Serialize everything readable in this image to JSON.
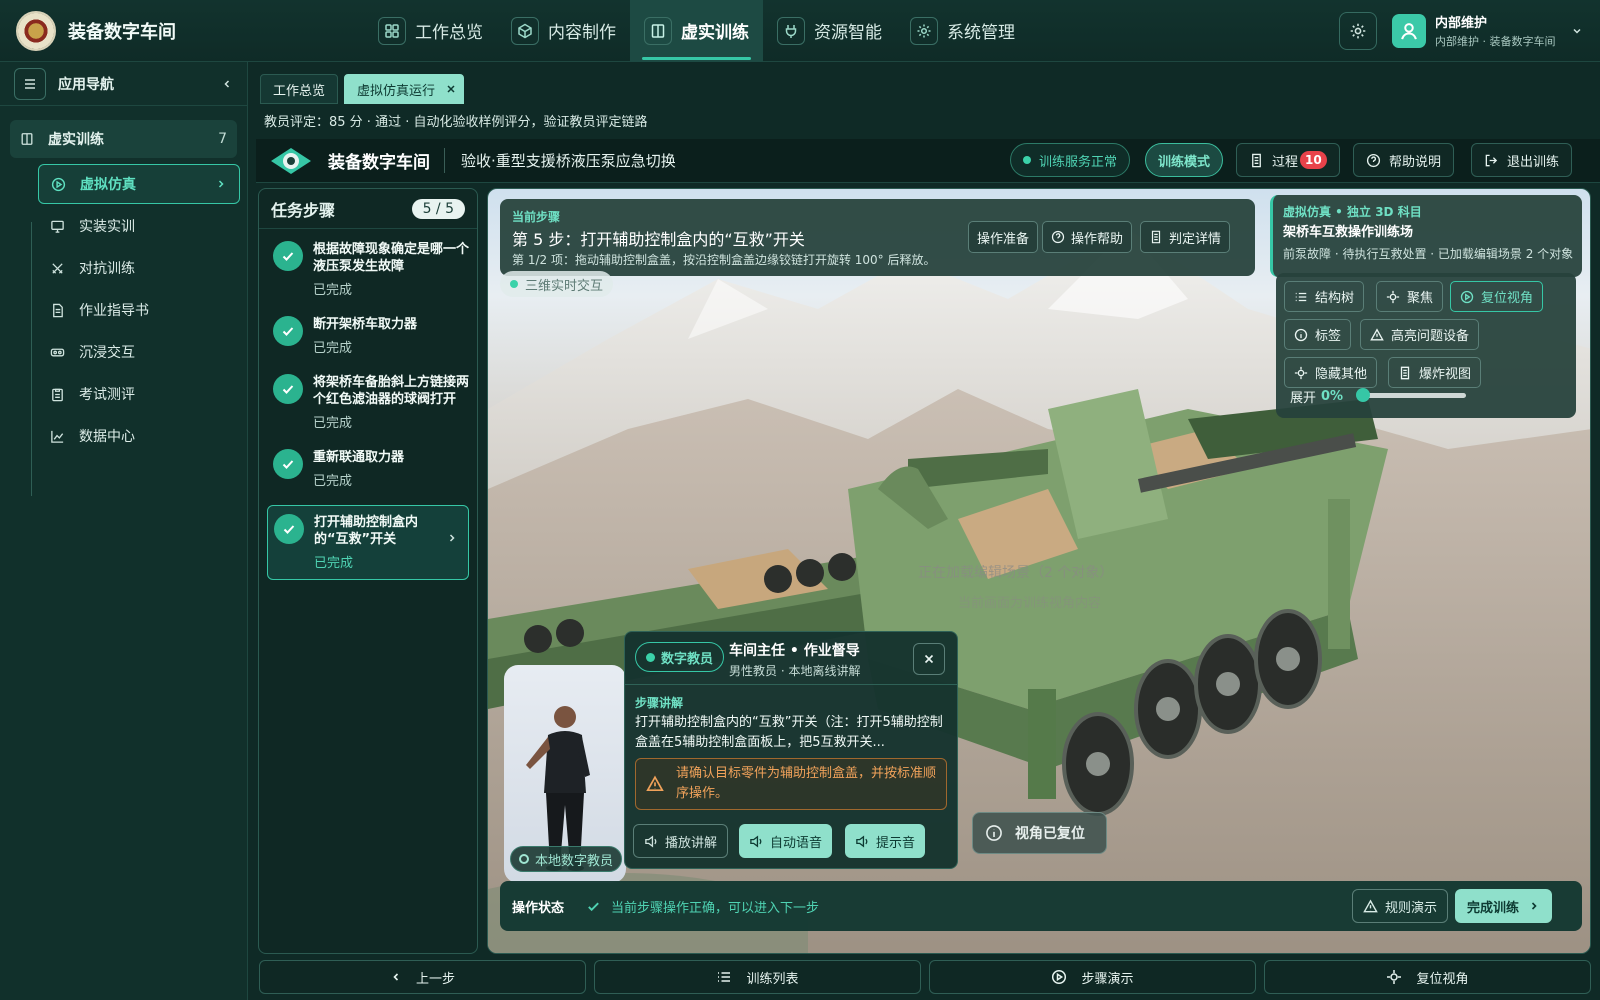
{
  "app": {
    "name": "装备数字车间"
  },
  "topnav": [
    {
      "label": "工作总览",
      "icon": "grid-icon"
    },
    {
      "label": "内容制作",
      "icon": "cube-icon"
    },
    {
      "label": "虚实训练",
      "icon": "book-icon",
      "active": true
    },
    {
      "label": "资源智能",
      "icon": "plug-icon"
    },
    {
      "label": "系统管理",
      "icon": "gear-icon"
    }
  ],
  "user": {
    "name": "内部维护",
    "sub": "内部维护 · 装备数字车间"
  },
  "sidebar": {
    "title": "应用导航",
    "group": {
      "label": "虚实训练",
      "count": "7"
    },
    "items": [
      {
        "label": "虚拟仿真",
        "active": true
      },
      {
        "label": "实装实训"
      },
      {
        "label": "对抗训练"
      },
      {
        "label": "作业指导书"
      },
      {
        "label": "沉浸交互"
      },
      {
        "label": "考试测评"
      },
      {
        "label": "数据中心"
      }
    ]
  },
  "tabs": [
    {
      "label": "工作总览"
    },
    {
      "label": "虚拟仿真运行",
      "active": true
    }
  ],
  "evaluation": "教员评定：85 分 · 通过 · 自动化验收样例评分，验证教员评定链路",
  "header": {
    "brand": "装备数字车间",
    "title": "验收·重型支援桥液压泵应急切换",
    "service_status": "训练服务正常",
    "mode": "训练模式",
    "process": "过程",
    "process_count": "10",
    "help": "帮助说明",
    "exit": "退出训练"
  },
  "steps": {
    "title": "任务步骤",
    "count": "5 / 5",
    "items": [
      {
        "text": "根据故障现象确定是哪一个液压泵发生故障",
        "status": "已完成"
      },
      {
        "text": "断开架桥车取力器",
        "status": "已完成"
      },
      {
        "text": "将架桥车备胎斜上方链接两个红色滤油器的球阀打开",
        "status": "已完成"
      },
      {
        "text": "重新联通取力器",
        "status": "已完成"
      },
      {
        "text": "打开辅助控制盒内的“互救”开关",
        "status": "已完成",
        "active": true
      }
    ]
  },
  "current_step": {
    "label": "当前步骤",
    "title": "第 5 步：打开辅助控制盒内的“互救”开关",
    "desc": "第 1/2 项：拖动辅助控制盒盖，按沿控制盒盖边缘铰链打开旋转 100° 后释放。",
    "buttons": [
      "操作准备",
      "操作帮助",
      "判定详情"
    ]
  },
  "live_tag": "三维实时交互",
  "subject": {
    "kicker": "虚拟仿真 • 独立 3D 科目",
    "title": "架桥车互救操作训练场",
    "desc": "前泵故障 · 待执行互救处置 · 已加载编辑场景 2 个对象"
  },
  "tools": {
    "buttons": [
      "结构树",
      "聚焦",
      "复位视角",
      "标签",
      "高亮问题设备",
      "隐藏其他",
      "爆炸视图"
    ],
    "expand_label": "展开",
    "expand_value": "0%",
    "expand_fraction": 0
  },
  "scene_ghost": {
    "line1": "正在加载编辑场景（2 个对象）",
    "line2": "当前画面为训练视角内容"
  },
  "teacher": {
    "tag": "本地数字教员"
  },
  "speech": {
    "badge": "数字教员",
    "name": "车间主任 • 作业督导",
    "sub": "男性教员 · 本地离线讲解",
    "section": "步骤讲解",
    "text": "打开辅助控制盒内的“互救”开关（注：打开5辅助控制盒盖在5辅助控制盒面板上，把5互救开关...",
    "warning": "请确认目标零件为辅助控制盒盖，并按标准顺序操作。",
    "buttons": [
      "播放讲解",
      "自动语音",
      "提示音"
    ]
  },
  "view_reset": "视角已复位",
  "status": {
    "label": "操作状态",
    "message": "当前步骤操作正确，可以进入下一步",
    "rule": "规则演示",
    "finish": "完成训练"
  },
  "bottom": [
    "上一步",
    "训练列表",
    "步骤演示",
    "复位视角"
  ],
  "colors": {
    "accent": "#36c7a6",
    "warning": "#f0a25a",
    "danger": "#e8424a"
  }
}
